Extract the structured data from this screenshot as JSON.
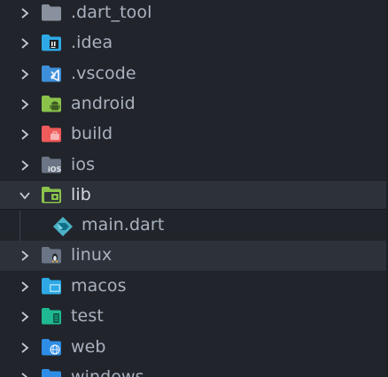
{
  "tree": {
    "items": [
      {
        "label": ".dart_tool",
        "icon": "folder-icon",
        "color": "#8a919e",
        "expanded": false
      },
      {
        "label": ".idea",
        "icon": "folder-intellij-icon",
        "color": "#2ea9e6",
        "expanded": false
      },
      {
        "label": ".vscode",
        "icon": "folder-vscode-icon",
        "color": "#3d8fd9",
        "expanded": false
      },
      {
        "label": "android",
        "icon": "folder-android-icon",
        "color": "#8bc34a",
        "expanded": false
      },
      {
        "label": "build",
        "icon": "folder-build-icon",
        "color": "#ef5a5a",
        "expanded": false
      },
      {
        "label": "ios",
        "icon": "folder-ios-icon",
        "color": "#6b7585",
        "expanded": false
      },
      {
        "label": "lib",
        "icon": "folder-lib-open-icon",
        "color": "#8bc34a",
        "expanded": true
      },
      {
        "label": "main.dart",
        "icon": "dart-file-icon",
        "color": "#4bb1c6",
        "child": true
      },
      {
        "label": "linux",
        "icon": "folder-linux-icon",
        "color": "#6b7585",
        "expanded": false
      },
      {
        "label": "macos",
        "icon": "folder-macos-icon",
        "color": "#2ea9e6",
        "expanded": false
      },
      {
        "label": "test",
        "icon": "folder-test-icon",
        "color": "#1fb992",
        "expanded": false
      },
      {
        "label": "web",
        "icon": "folder-web-icon",
        "color": "#2e8de6",
        "expanded": false
      },
      {
        "label": "windows",
        "icon": "folder-windows-icon",
        "color": "#2e8de6",
        "expanded": false
      }
    ]
  },
  "colors": {
    "background": "#21252b",
    "active_row": "#2c313a",
    "text": "#abb2bf",
    "chevron": "#c5c9d0"
  }
}
